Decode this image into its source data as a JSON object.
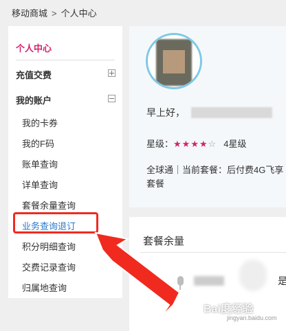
{
  "breadcrumb": {
    "home": "移动商城",
    "separator": ">",
    "current": "个人中心"
  },
  "sidebar": {
    "title": "个人中心",
    "groups": [
      {
        "label": "充值交费",
        "toggle": "+"
      },
      {
        "label": "我的账户",
        "toggle": "−"
      }
    ],
    "items": [
      {
        "label": "我的卡券"
      },
      {
        "label": "我的F码"
      },
      {
        "label": "账单查询"
      },
      {
        "label": "详单查询"
      },
      {
        "label": "套餐余量查询"
      },
      {
        "label": "业务查询退订",
        "active": true
      },
      {
        "label": "积分明细查询"
      },
      {
        "label": "交费记录查询"
      },
      {
        "label": "归属地查询"
      }
    ]
  },
  "profile": {
    "greeting": "早上好，",
    "star_label": "星级：",
    "stars_filled": 4,
    "stars_total": 5,
    "star_level": "4星级",
    "plan": "全球通｜当前套餐：后付费4G飞享套餐"
  },
  "balance": {
    "title": "套餐余量",
    "edge_char": "是"
  },
  "watermark": {
    "text": "Bai度经验",
    "url": "jingyan.baidu.com"
  },
  "colors": {
    "accent": "#d0246b",
    "active_link": "#2a79c9",
    "highlight": "#f02a1f",
    "avatar_ring": "#7ec9e6"
  }
}
